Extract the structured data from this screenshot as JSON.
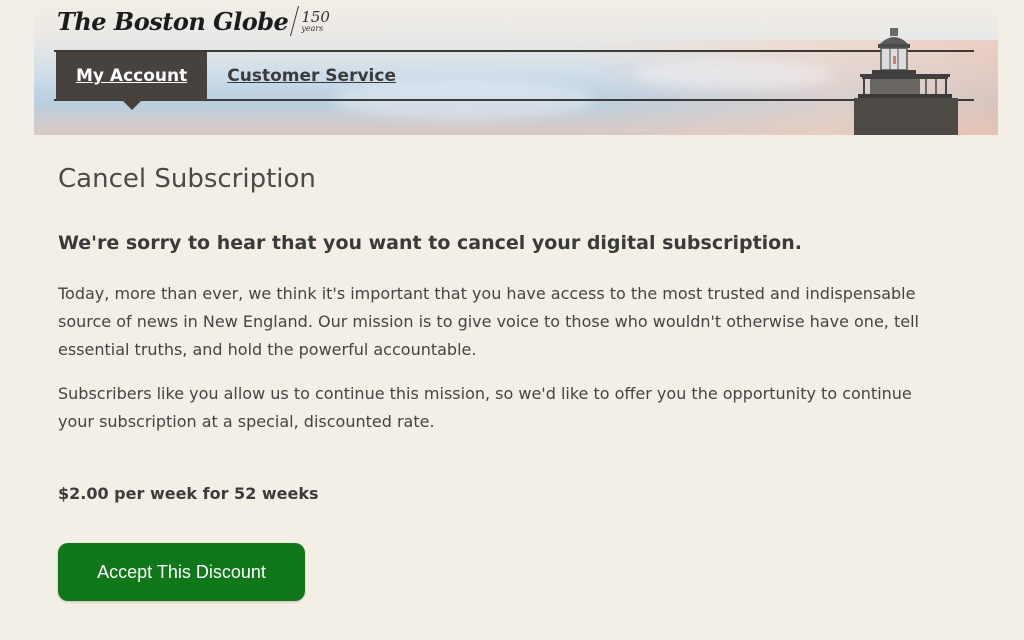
{
  "header": {
    "logo_text": "The Boston Globe",
    "logo_anniversary": "150",
    "logo_anniversary_sub": "years",
    "nav": [
      {
        "label": "My Account",
        "active": true
      },
      {
        "label": "Customer Service",
        "active": false
      }
    ]
  },
  "main": {
    "title": "Cancel Subscription",
    "subhead": "We're sorry to hear that you want to cancel your digital subscription.",
    "paragraphs": [
      "Today, more than ever, we think it's important that you have access to the most trusted and indispensable source of news in New England. Our mission is to give voice to those who wouldn't otherwise have one, tell essential truths, and hold the powerful accountable.",
      "Subscribers like you allow us to continue this mission, so we'd like to offer you the opportunity to continue your subscription at a special, discounted rate."
    ],
    "offer": "$2.00 per week for 52 weeks",
    "accept_button": "Accept This Discount"
  },
  "colors": {
    "background": "#f3efe6",
    "nav_active": "#47423d",
    "button": "#10771a"
  },
  "icons": [
    "lighthouse-illustration"
  ]
}
